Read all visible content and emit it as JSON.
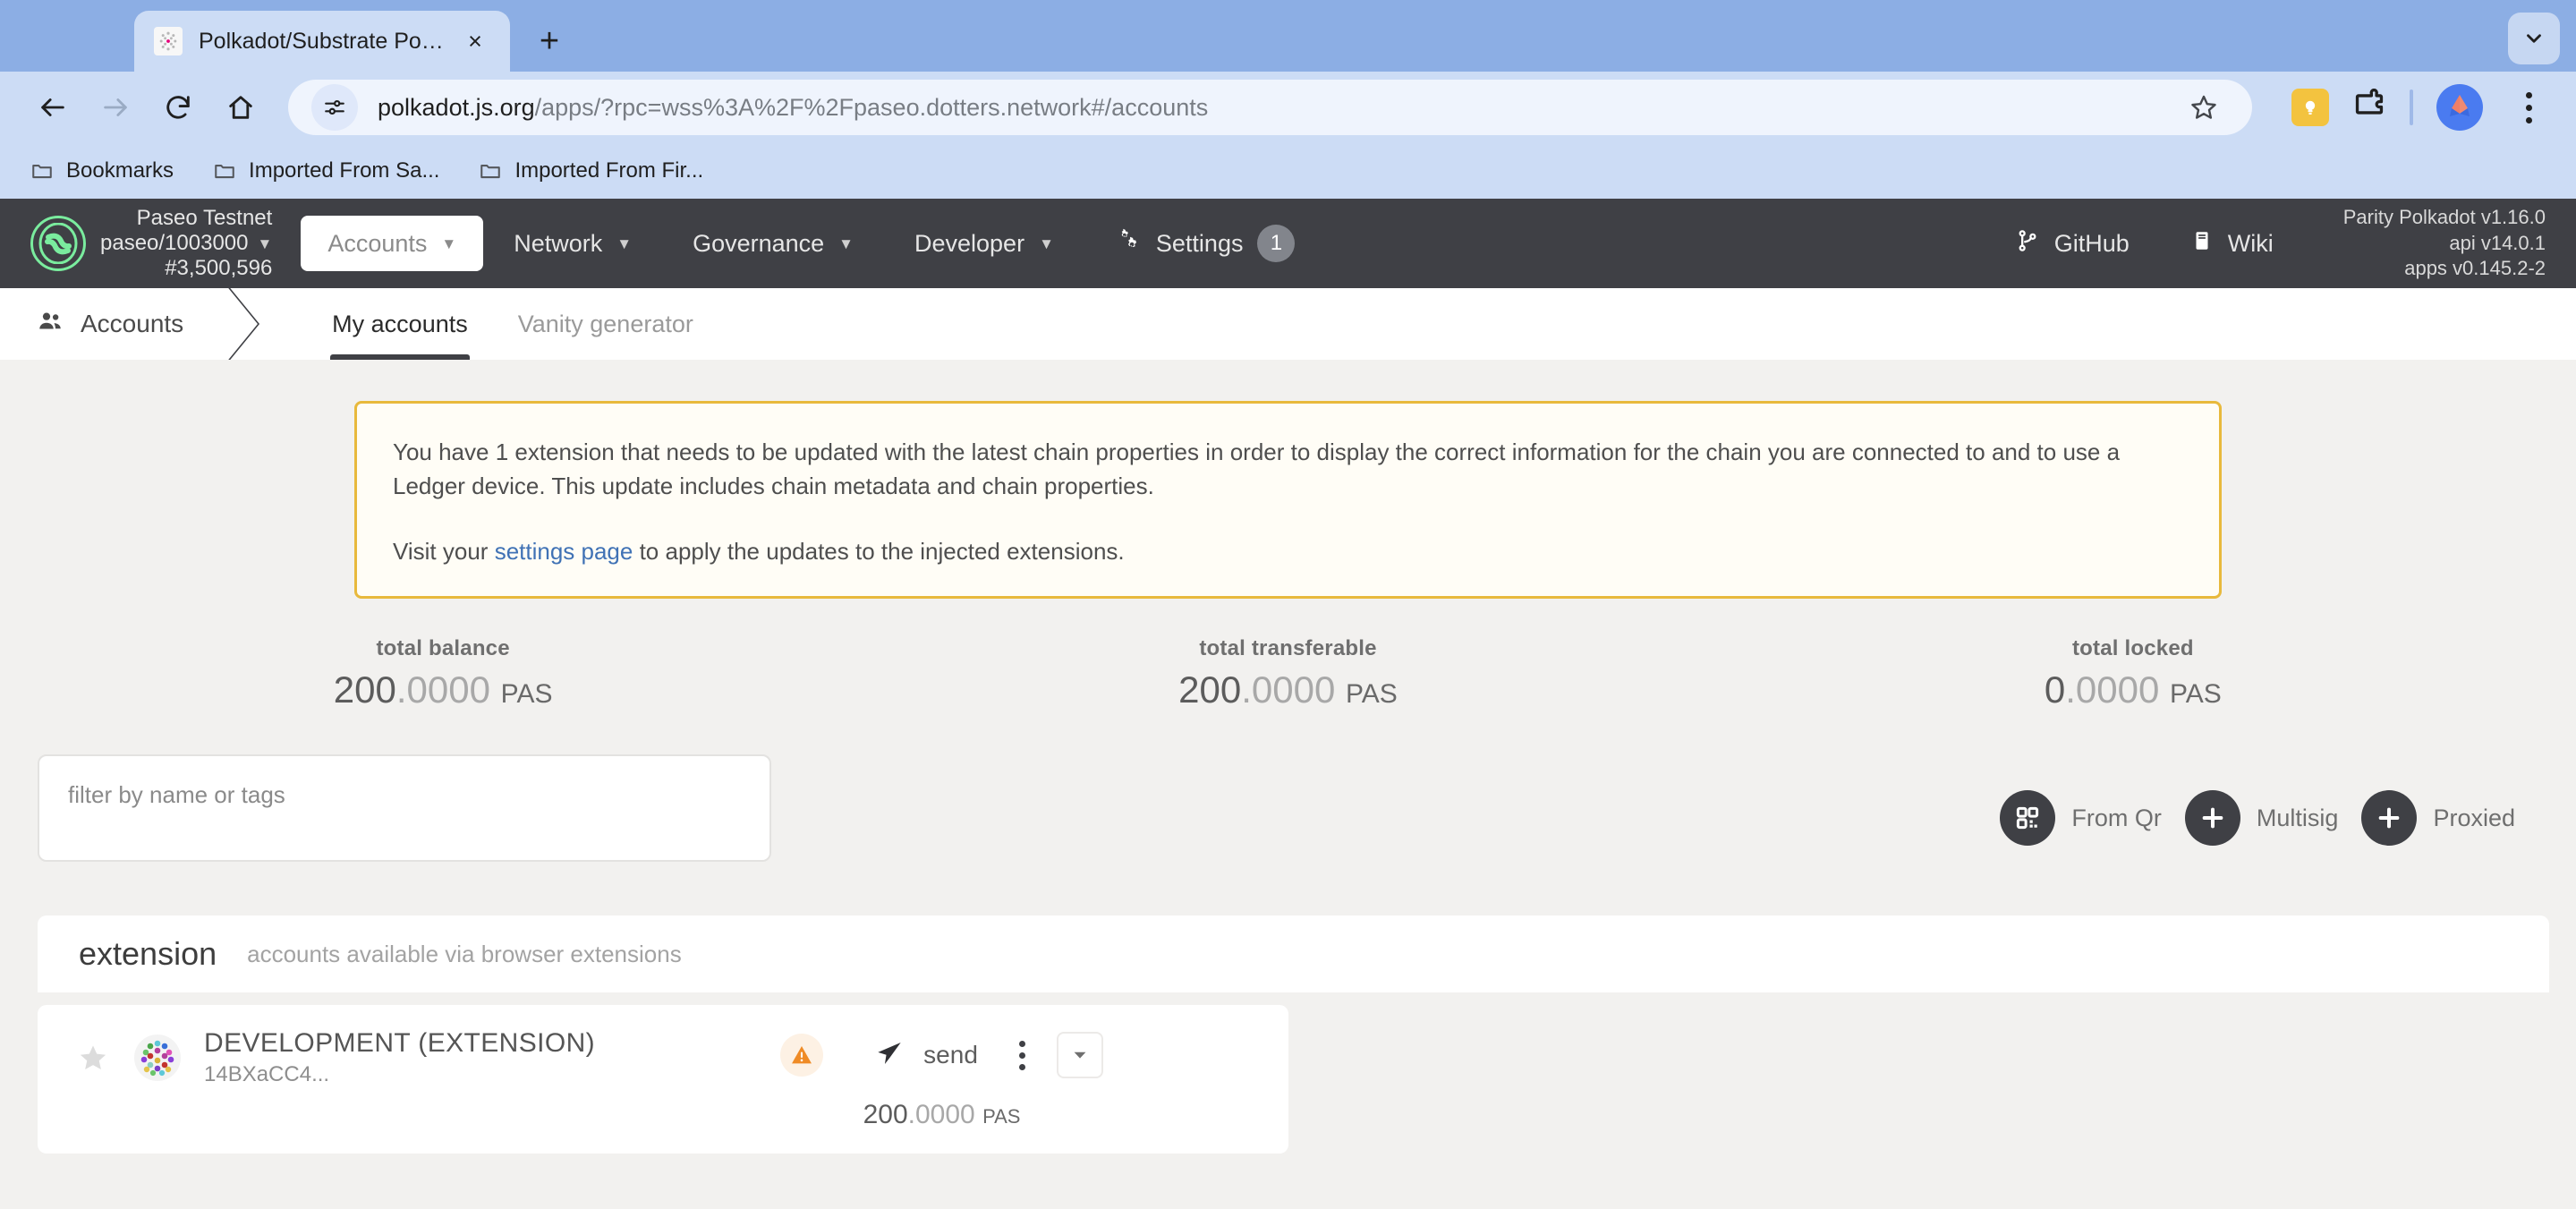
{
  "browser": {
    "tab": {
      "title": "Polkadot/Substrate Portal",
      "favicon": "polkadot-favicon"
    },
    "new_tab_label": "+",
    "close_label": "×",
    "url_host": "polkadot.js.org",
    "url_path": "/apps/?rpc=wss%3A%2F%2Fpaseo.dotters.network#/accounts",
    "bookmarks": [
      {
        "label": "Bookmarks"
      },
      {
        "label": "Imported From Sa..."
      },
      {
        "label": "Imported From Fir..."
      }
    ]
  },
  "appnav": {
    "chain": {
      "name": "Paseo Testnet",
      "spec": "paseo/1003000",
      "block": "#3,500,596"
    },
    "items": [
      {
        "label": "Accounts",
        "active": true,
        "caret": true
      },
      {
        "label": "Network",
        "active": false,
        "caret": true
      },
      {
        "label": "Governance",
        "active": false,
        "caret": true
      },
      {
        "label": "Developer",
        "active": false,
        "caret": true
      },
      {
        "label": "Settings",
        "active": false,
        "caret": false,
        "badge": "1"
      }
    ],
    "links": [
      {
        "label": "GitHub",
        "icon": "git-branch-icon"
      },
      {
        "label": "Wiki",
        "icon": "book-icon"
      }
    ],
    "versions": {
      "node": "Parity Polkadot v1.16.0",
      "api": "api v14.0.1",
      "apps": "apps v0.145.2-2"
    }
  },
  "subnav": {
    "breadcrumb": "Accounts",
    "tabs": [
      {
        "label": "My accounts",
        "active": true
      },
      {
        "label": "Vanity generator",
        "active": false
      }
    ]
  },
  "banner": {
    "paragraph1": "You have 1 extension that needs to be updated with the latest chain properties in order to display the correct information for the chain you are connected to and to use a Ledger device. This update includes chain metadata and chain properties.",
    "line2_before": "Visit your ",
    "line2_link": "settings page",
    "line2_after": " to apply the updates to the injected extensions.",
    "border_color": "#e8b93c",
    "bg_color": "#fffdf6"
  },
  "summary": [
    {
      "label": "total balance",
      "whole": "200",
      "dec": ".0000",
      "unit": "PAS"
    },
    {
      "label": "total transferable",
      "whole": "200",
      "dec": ".0000",
      "unit": "PAS"
    },
    {
      "label": "total locked",
      "whole": "0",
      "dec": ".0000",
      "unit": "PAS"
    }
  ],
  "filter": {
    "placeholder": "filter by name or tags",
    "value": ""
  },
  "actions": [
    {
      "label": "From Qr",
      "icon": "qr-code-icon"
    },
    {
      "label": "Multisig",
      "icon": "plus-icon"
    },
    {
      "label": "Proxied",
      "icon": "plus-icon"
    }
  ],
  "section": {
    "title": "extension",
    "subtitle": "accounts available via browser extensions"
  },
  "account": {
    "name": "DEVELOPMENT (EXTENSION)",
    "address": "14BXaCC4...",
    "send_label": "send",
    "balance_whole": "200",
    "balance_dec": ".0000",
    "balance_unit": "PAS",
    "warning_icon": "warning-triangle-icon",
    "favorite_icon": "star-icon"
  },
  "colors": {
    "nav_bg": "#3f4045",
    "page_bg": "#f2f1ef",
    "accent_green": "#7aec9e",
    "warning_orange": "#ef8b26",
    "link_blue": "#4072b5"
  }
}
